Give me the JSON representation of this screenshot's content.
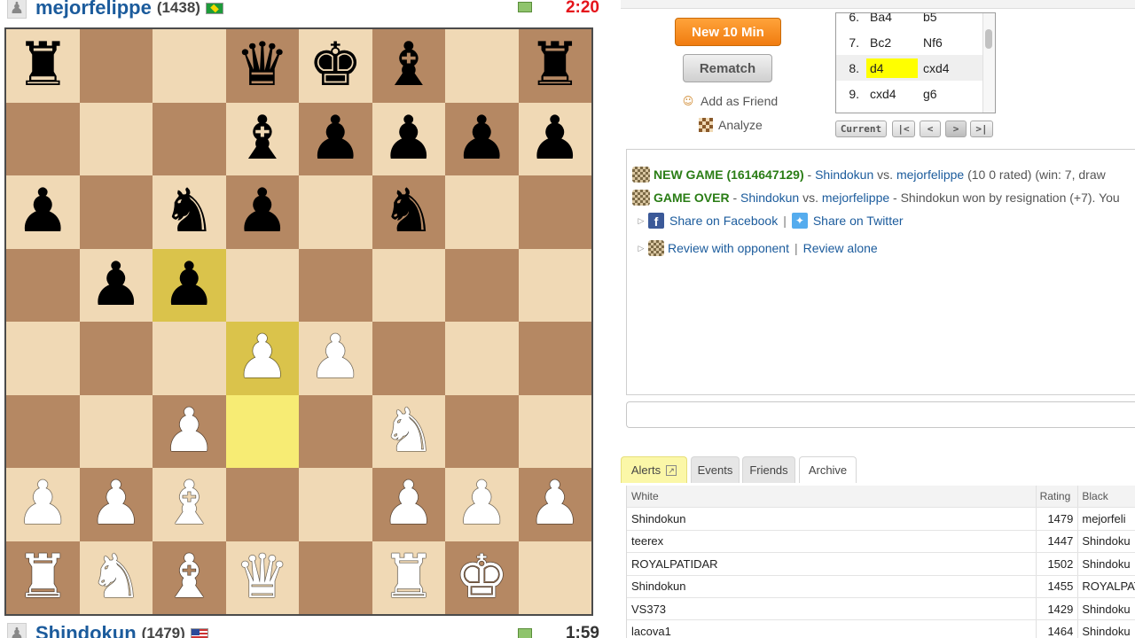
{
  "top_player": {
    "name": "mejorfelippe",
    "rating": "(1438)",
    "flag": "brazil-flag",
    "clock": "2:20",
    "clock_color": "#e5141b"
  },
  "bottom_player": {
    "name": "Shindokun",
    "rating": "(1479)",
    "flag": "usa-flag",
    "clock": "1:59"
  },
  "board": {
    "light_color": "#f0d9b5",
    "dark_color": "#b58863",
    "highlight_colors": [
      "#dac34b",
      "#f7ec74"
    ],
    "highlighted_squares": [
      "c5",
      "d4",
      "d3"
    ],
    "rows": [
      [
        "♜",
        "",
        "",
        "♛",
        "♚",
        "♝",
        "",
        "♜"
      ],
      [
        "",
        "",
        "",
        "♝",
        "♟",
        "♟",
        "♟",
        "♟"
      ],
      [
        "♟",
        "",
        "♞",
        "♟",
        "",
        "♞",
        "",
        ""
      ],
      [
        "",
        "♟",
        "♟",
        "",
        "",
        "",
        "",
        ""
      ],
      [
        "",
        "",
        "",
        "♙",
        "♙",
        "",
        "",
        ""
      ],
      [
        "",
        "",
        "♙",
        "",
        "",
        "♘",
        "",
        ""
      ],
      [
        "♙",
        "♙",
        "♗",
        "",
        "",
        "♙",
        "♙",
        "♙"
      ],
      [
        "♖",
        "♘",
        "♗",
        "♕",
        "",
        "♖",
        "♔",
        ""
      ]
    ],
    "colors": [
      [
        "b",
        "",
        "",
        "b",
        "b",
        "b",
        "",
        "b"
      ],
      [
        "",
        "",
        "",
        "b",
        "b",
        "b",
        "b",
        "b"
      ],
      [
        "b",
        "",
        "b",
        "b",
        "",
        "b",
        "",
        ""
      ],
      [
        "",
        "b",
        "b",
        "",
        "",
        "",
        "",
        ""
      ],
      [
        "",
        "",
        "",
        "w",
        "w",
        "",
        "",
        ""
      ],
      [
        "",
        "",
        "w",
        "",
        "",
        "w",
        "",
        ""
      ],
      [
        "w",
        "w",
        "w",
        "",
        "",
        "w",
        "w",
        "w"
      ],
      [
        "w",
        "w",
        "w",
        "w",
        "",
        "w",
        "w",
        ""
      ]
    ]
  },
  "actions": {
    "new_game": "New 10 Min",
    "rematch": "Rematch",
    "add_friend": "Add as Friend",
    "analyze": "Analyze"
  },
  "moves": [
    {
      "num": "6.",
      "white": "Ba4",
      "black": "b5",
      "current": false
    },
    {
      "num": "7.",
      "white": "Bc2",
      "black": "Nf6",
      "current": false
    },
    {
      "num": "8.",
      "white": "d4",
      "black": "cxd4",
      "current": true
    },
    {
      "num": "9.",
      "white": "cxd4",
      "black": "g6",
      "current": false
    }
  ],
  "move_nav": {
    "current": "Current",
    "first": "|<",
    "prev": "<",
    "next": ">",
    "last": ">|"
  },
  "console": {
    "new_game_label": "NEW GAME (1614647129)",
    "new_game_dash": " - ",
    "new_game_white": "Shindokun",
    "vs1": " vs. ",
    "new_game_black": "mejorfelippe",
    "new_game_info": " (10 0 rated) (win: 7, draw",
    "game_over_label": "GAME OVER",
    "game_over_dash": " - ",
    "game_over_white": "Shindokun",
    "vs2": " vs. ",
    "game_over_black": "mejorfelippe",
    "game_over_info": " - Shindokun won by resignation (+7). You",
    "share_facebook": "Share on Facebook",
    "share_sep": "|",
    "share_twitter": "Share on Twitter",
    "review_opponent": "Review with opponent",
    "review_sep": "|",
    "review_alone": "Review alone"
  },
  "tabs": [
    "Alerts",
    "Events",
    "Friends",
    "Archive"
  ],
  "games_table": {
    "headers": {
      "white": "White",
      "rating": "Rating",
      "black": "Black"
    },
    "rows": [
      {
        "white": "Shindokun",
        "rating": "1479",
        "black": "mejorfeli"
      },
      {
        "white": "teerex",
        "rating": "1447",
        "black": "Shindoku"
      },
      {
        "white": "ROYALPATIDAR",
        "rating": "1502",
        "black": "Shindoku"
      },
      {
        "white": "Shindokun",
        "rating": "1455",
        "black": "ROYALPAT"
      },
      {
        "white": "VS373",
        "rating": "1429",
        "black": "Shindoku"
      },
      {
        "white": "lacova1",
        "rating": "1464",
        "black": "Shindoku"
      }
    ]
  }
}
